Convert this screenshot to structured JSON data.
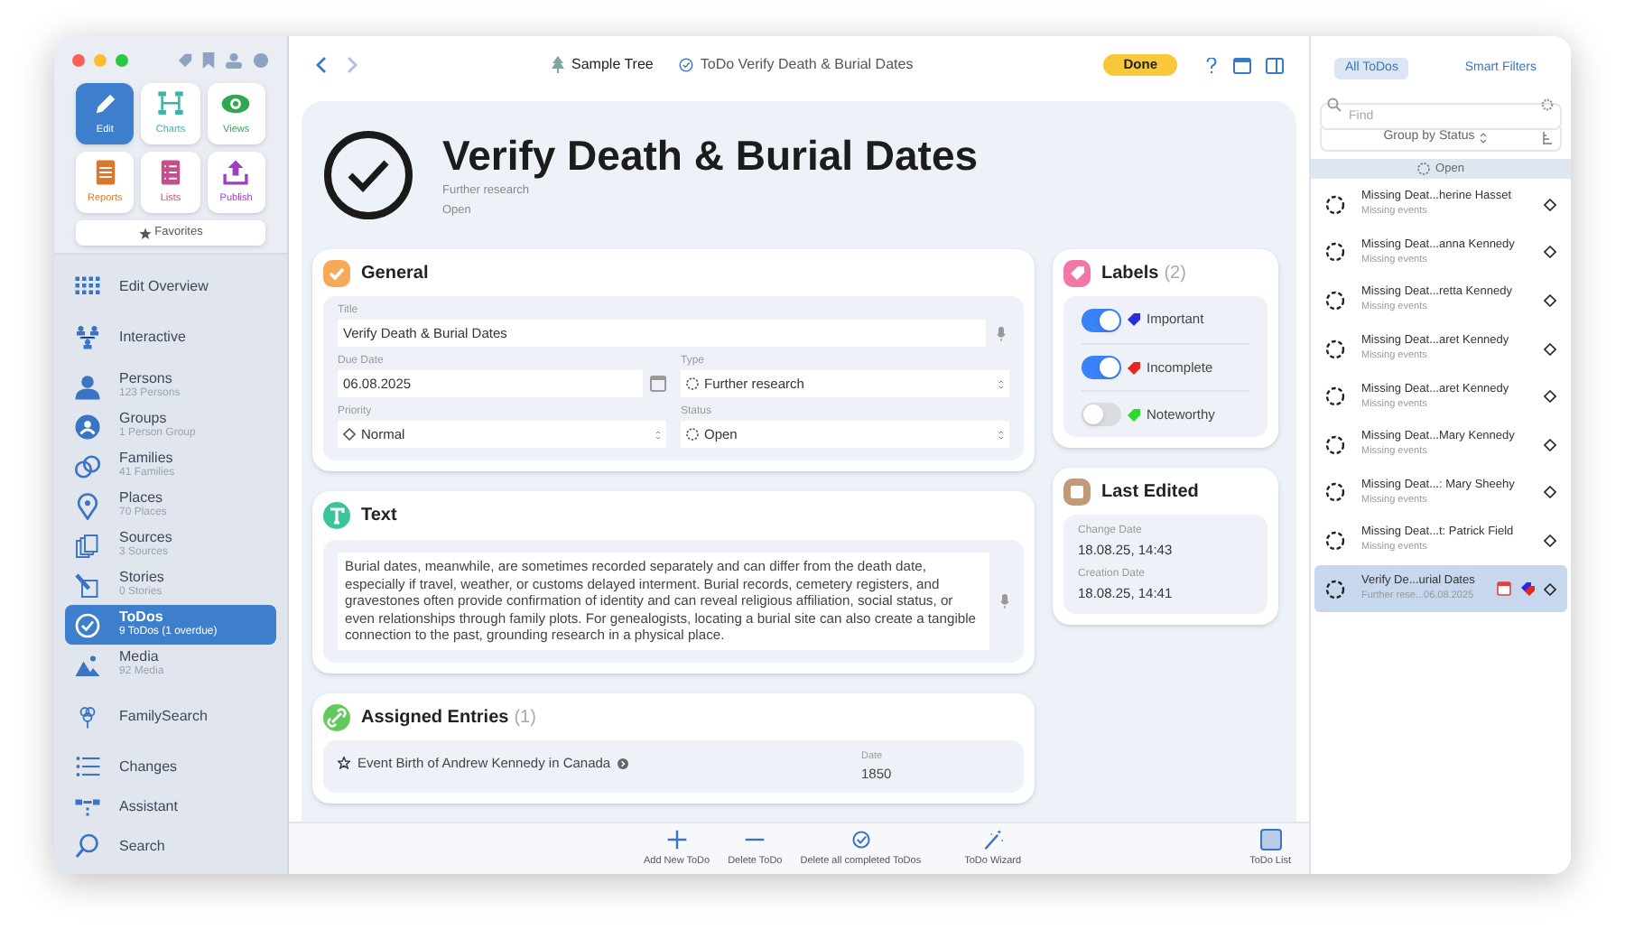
{
  "sidebar": {
    "tiles": [
      {
        "label": "Edit",
        "selected": true
      },
      {
        "label": "Charts",
        "selected": false
      },
      {
        "label": "Views",
        "selected": false
      },
      {
        "label": "Reports",
        "selected": false
      },
      {
        "label": "Lists",
        "selected": false
      },
      {
        "label": "Publish",
        "selected": false
      }
    ],
    "favorites": "Favorites",
    "items": [
      {
        "label": "Edit Overview",
        "selected": false
      },
      {
        "label": "Interactive",
        "selected": false
      },
      {
        "label": "Persons",
        "subtitle": "123 Persons",
        "selected": false
      },
      {
        "label": "Groups",
        "subtitle": "1 Person Group",
        "selected": false
      },
      {
        "label": "Families",
        "subtitle": "41 Families",
        "selected": false
      },
      {
        "label": "Places",
        "subtitle": "70 Places",
        "selected": false
      },
      {
        "label": "Sources",
        "subtitle": "3 Sources",
        "selected": false
      },
      {
        "label": "Stories",
        "subtitle": "0 Stories",
        "selected": false
      },
      {
        "label": "ToDos",
        "subtitle": "9 ToDos (1 overdue)",
        "selected": true
      },
      {
        "label": "Media",
        "subtitle": "92 Media",
        "selected": false
      },
      {
        "label": "FamilySearch",
        "selected": false
      },
      {
        "label": "Changes",
        "selected": false
      },
      {
        "label": "Assistant",
        "selected": false
      },
      {
        "label": "Search",
        "selected": false
      }
    ]
  },
  "toolbar": {
    "breadcrumbs": [
      "Sample Tree",
      "ToDo Verify Death & Burial Dates"
    ],
    "done_button": "Done"
  },
  "header": {
    "title": "Verify Death & Burial Dates",
    "type": "Further research",
    "status": "Open"
  },
  "general": {
    "title": "General",
    "fields": [
      {
        "label": "Title",
        "value": "Verify Death & Burial Dates",
        "kind": "text"
      },
      {
        "label": "Due Date",
        "value": "06.08.2025",
        "kind": "date"
      },
      {
        "label": "Type",
        "value": "Further research",
        "kind": "select"
      },
      {
        "label": "Priority",
        "value": "Normal",
        "kind": "select"
      },
      {
        "label": "Status",
        "value": "Open",
        "kind": "select"
      }
    ]
  },
  "text_section": {
    "title": "Text",
    "body": "Burial dates, meanwhile, are sometimes recorded separately and can differ from the death date, especially if travel, weather, or customs delayed interment. Burial records, cemetery registers, and gravestones often provide confirmation of identity and can reveal religious affiliation, social status, or even relationships through family plots. For genealogists, locating a burial site can also create a tangible connection to the past, grounding research in a physical place."
  },
  "assigned": {
    "title": "Assigned Entries",
    "count": "(1)",
    "entries": [
      {
        "name": "Event Birth of Andrew Kennedy in Canada",
        "date_label": "Date",
        "date": "1850"
      }
    ]
  },
  "labels": {
    "title": "Labels",
    "count": "(2)",
    "items": [
      {
        "name": "Important",
        "on": true,
        "color": "#2a2ae0"
      },
      {
        "name": "Incomplete",
        "on": true,
        "color": "#e8261c"
      },
      {
        "name": "Noteworthy",
        "on": false,
        "color": "#2ed82e"
      }
    ]
  },
  "last_edited": {
    "title": "Last Edited",
    "fields": [
      {
        "label": "Change Date",
        "value": "18.08.25, 14:43"
      },
      {
        "label": "Creation Date",
        "value": "18.08.25, 14:41"
      }
    ]
  },
  "todo_list": {
    "tabs": [
      {
        "label": "All ToDos",
        "selected": true
      },
      {
        "label": "Smart Filters",
        "selected": false
      }
    ],
    "search": {
      "placeholder": "Find"
    },
    "group_by": "Group by Status",
    "group": "Open",
    "items": [
      {
        "title": "Missing Deat...herine Hasset",
        "subtitle": "Missing events",
        "kind": "plain",
        "selected": false
      },
      {
        "title": "Missing Deat...anna Kennedy",
        "subtitle": "Missing events",
        "kind": "plain",
        "selected": false
      },
      {
        "title": "Missing Deat...retta Kennedy",
        "subtitle": "Missing events",
        "kind": "plain",
        "selected": false
      },
      {
        "title": "Missing Deat...aret Kennedy",
        "subtitle": "Missing events",
        "kind": "plain",
        "selected": false
      },
      {
        "title": "Missing Deat...aret Kennedy",
        "subtitle": "Missing events",
        "kind": "plain",
        "selected": false
      },
      {
        "title": "Missing Deat...Mary Kennedy",
        "subtitle": "Missing events",
        "kind": "plain",
        "selected": false
      },
      {
        "title": "Missing Deat...: Mary Sheehy",
        "subtitle": "Missing events",
        "kind": "plain",
        "selected": false
      },
      {
        "title": "Missing Deat...t: Patrick Field",
        "subtitle": "Missing events",
        "kind": "plain",
        "selected": false
      },
      {
        "title": "Verify De...urial Dates",
        "subtitle": "Further rese...06.08.2025",
        "kind": "tagged",
        "selected": true
      }
    ]
  },
  "bottom_toolbar": {
    "buttons": [
      "Add New ToDo",
      "Delete ToDo",
      "Delete all completed ToDos",
      "ToDo Wizard"
    ],
    "list_button": "ToDo List"
  }
}
